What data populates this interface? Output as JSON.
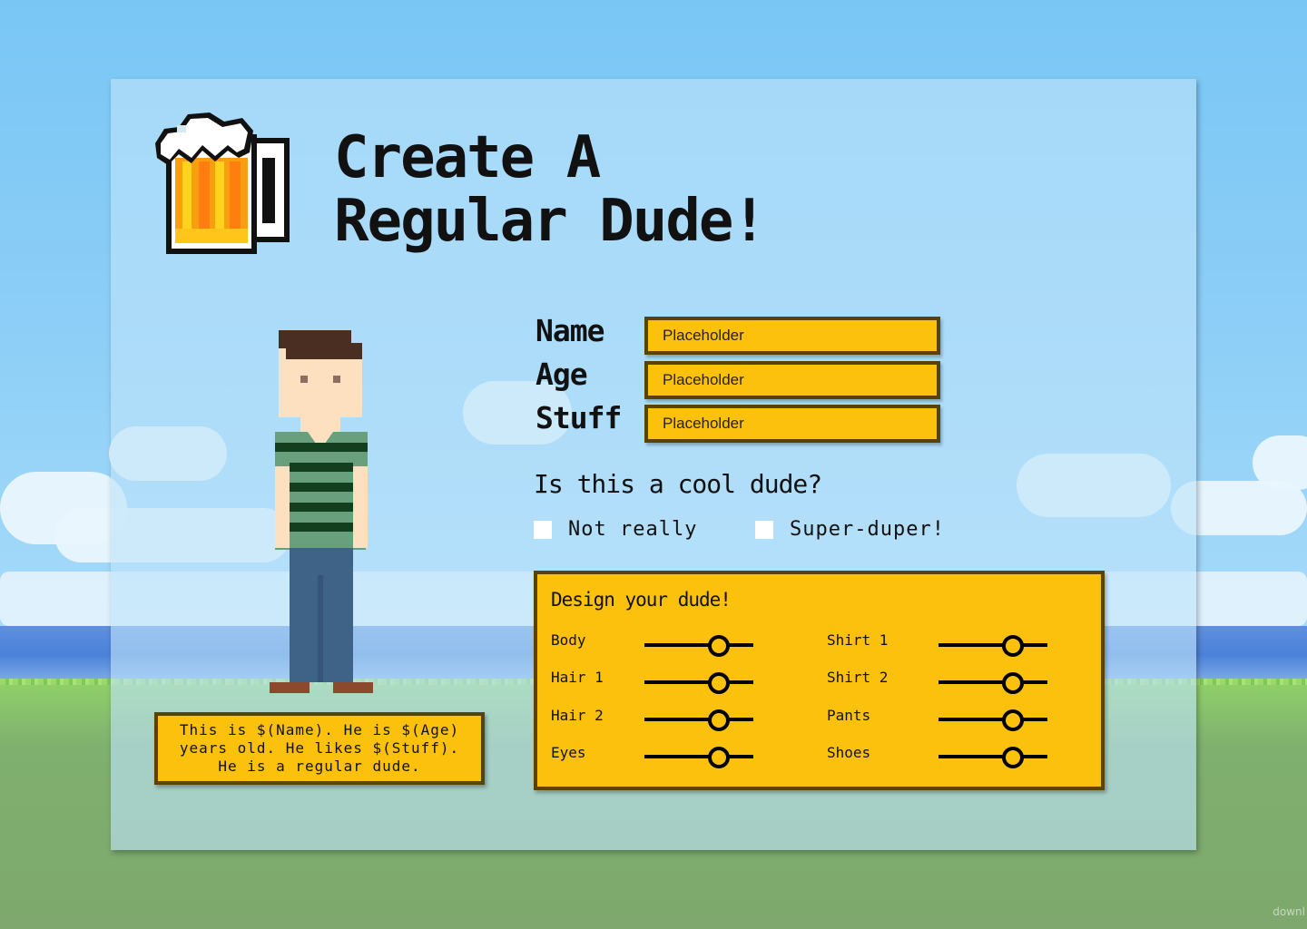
{
  "title": {
    "line1": "Create A",
    "line2": "Regular Dude!"
  },
  "form": {
    "fields": [
      {
        "label": "Name",
        "placeholder": "Placeholder"
      },
      {
        "label": "Age",
        "placeholder": "Placeholder"
      },
      {
        "label": "Stuff",
        "placeholder": "Placeholder"
      }
    ],
    "question": "Is this a cool dude?",
    "options": [
      {
        "label": "Not really",
        "checked": false
      },
      {
        "label": "Super-duper!",
        "checked": false
      }
    ]
  },
  "bio": {
    "text": "This is $(Name). He is $(Age) years old. He likes $(Stuff). He is a regular dude."
  },
  "design": {
    "title": "Design your dude!",
    "sliders": [
      {
        "label": "Body",
        "value": 0.68
      },
      {
        "label": "Hair 1",
        "value": 0.68
      },
      {
        "label": "Hair 2",
        "value": 0.68
      },
      {
        "label": "Eyes",
        "value": 0.68
      },
      {
        "label": "Shirt 1",
        "value": 0.68
      },
      {
        "label": "Shirt 2",
        "value": 0.68
      },
      {
        "label": "Pants",
        "value": 0.68
      },
      {
        "label": "Shoes",
        "value": 0.68
      }
    ]
  },
  "colors": {
    "accent": "#fcc10d",
    "accent_border": "#5a4204",
    "sky": "#79c6f5",
    "grass": "#7ea86d"
  },
  "dude": {
    "hair_color": "#4a2e22",
    "skin_color": "#fde0c0",
    "shirt_colors": [
      "#6a9f7e",
      "#133f1f"
    ],
    "pants_color": "#3f6287",
    "shoes_color": "#8b4a2b"
  },
  "watermark": "downl"
}
